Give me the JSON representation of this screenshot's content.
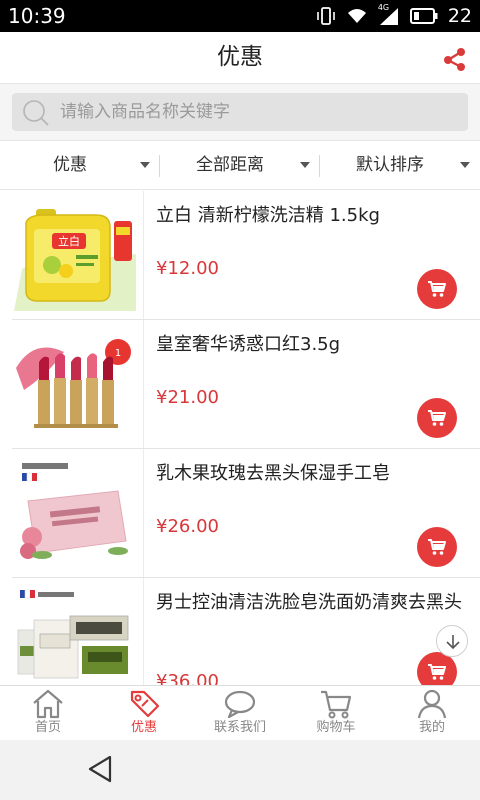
{
  "status_bar": {
    "time": "10:39",
    "network_type": "4G",
    "battery_level": "22"
  },
  "header": {
    "title": "优惠"
  },
  "search": {
    "placeholder": "请输入商品名称关键字",
    "value": ""
  },
  "filters": [
    {
      "label": "优惠"
    },
    {
      "label": "全部距离"
    },
    {
      "label": "默认排序"
    }
  ],
  "products": [
    {
      "name": "立白 清新柠檬洗洁精 1.5kg",
      "price": "¥12.00",
      "thumb_icon": "dish-soap-bottle",
      "thumb_text": "立白"
    },
    {
      "name": "皇室奢华诱惑口红3.5g",
      "price": "¥21.00",
      "thumb_icon": "lipsticks"
    },
    {
      "name": "乳木果玫瑰去黑头保湿手工皂",
      "price": "¥26.00",
      "thumb_icon": "rose-soap-bar"
    },
    {
      "name": "男士控油清洁洗脸皂洗面奶清爽去黑头",
      "price": "¥36.00",
      "thumb_icon": "mens-soap-set"
    }
  ],
  "bottom_nav": [
    {
      "label": "首页",
      "icon": "home-icon",
      "active": false
    },
    {
      "label": "优惠",
      "icon": "tag-icon",
      "active": true
    },
    {
      "label": "联系我们",
      "icon": "chat-icon",
      "active": false
    },
    {
      "label": "购物车",
      "icon": "cart-icon",
      "active": false
    },
    {
      "label": "我的",
      "icon": "user-icon",
      "active": false
    }
  ],
  "colors": {
    "accent": "#e53b3b",
    "price": "#d9383a",
    "inactive": "#888888"
  }
}
